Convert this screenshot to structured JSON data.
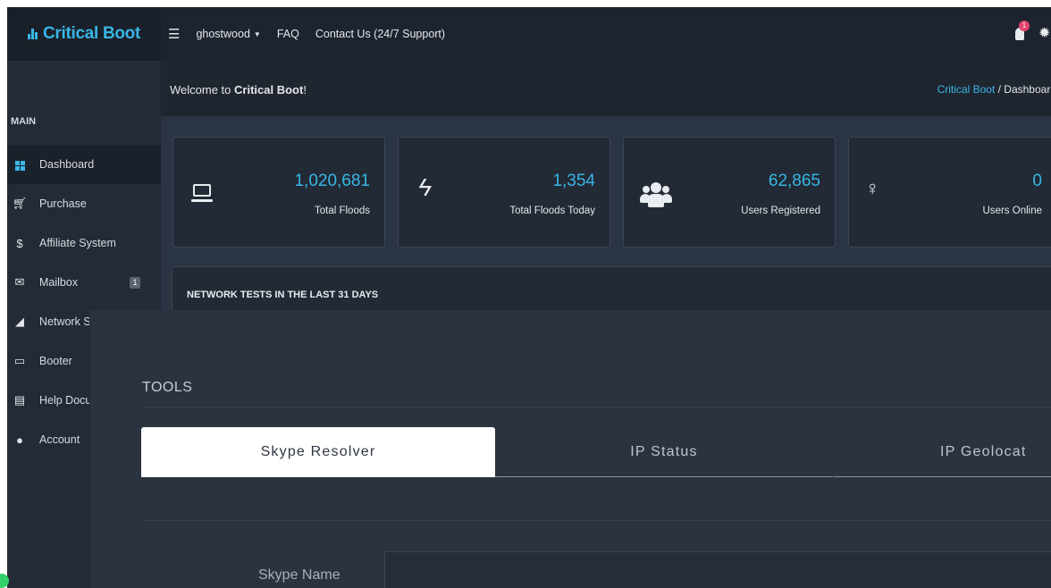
{
  "brand": {
    "name": "Critical Boot",
    "color": "#38b6e6"
  },
  "topnav": {
    "menu_icon": "hamburger-icon",
    "user": "ghostwood",
    "faq": "FAQ",
    "contact": "Contact Us (24/7 Support)",
    "notifications_count": "1"
  },
  "sidebar": {
    "heading": "MAIN",
    "items": [
      {
        "label": "Dashboard",
        "icon": "dashboard-icon",
        "active": true
      },
      {
        "label": "Purchase",
        "icon": "cart-icon"
      },
      {
        "label": "Affiliate System",
        "icon": "dollar-icon"
      },
      {
        "label": "Mailbox",
        "icon": "mail-icon",
        "badge": "1"
      },
      {
        "label": "Network St",
        "icon": "signal-icon"
      },
      {
        "label": "Booter",
        "icon": "laptop-icon"
      },
      {
        "label": "Help Docum",
        "icon": "document-icon"
      },
      {
        "label": "Account",
        "icon": "user-icon"
      }
    ]
  },
  "welcome": {
    "prefix": "Welcome to ",
    "name": "Critical Boot",
    "suffix": "!"
  },
  "breadcrumb": {
    "root": "Critical Boot",
    "separator": "/",
    "current": "Dashboard"
  },
  "stats": [
    {
      "value": "1,020,681",
      "label": "Total Floods",
      "icon": "laptop-icon"
    },
    {
      "value": "1,354",
      "label": "Total Floods Today",
      "icon": "bolt-icon"
    },
    {
      "value": "62,865",
      "label": "Users Registered",
      "icon": "users-icon"
    },
    {
      "value": "0",
      "label": "Users Online",
      "icon": "lightbulb-icon"
    }
  ],
  "network_panel": {
    "title": "NETWORK TESTS IN THE LAST 31 DAYS"
  },
  "tools": {
    "title": "TOOLS",
    "tabs": [
      {
        "label": "Skype Resolver",
        "active": true
      },
      {
        "label": "IP Status"
      },
      {
        "label": "IP Geolocat"
      }
    ],
    "field_label": "Skype Name",
    "field_value": ""
  }
}
